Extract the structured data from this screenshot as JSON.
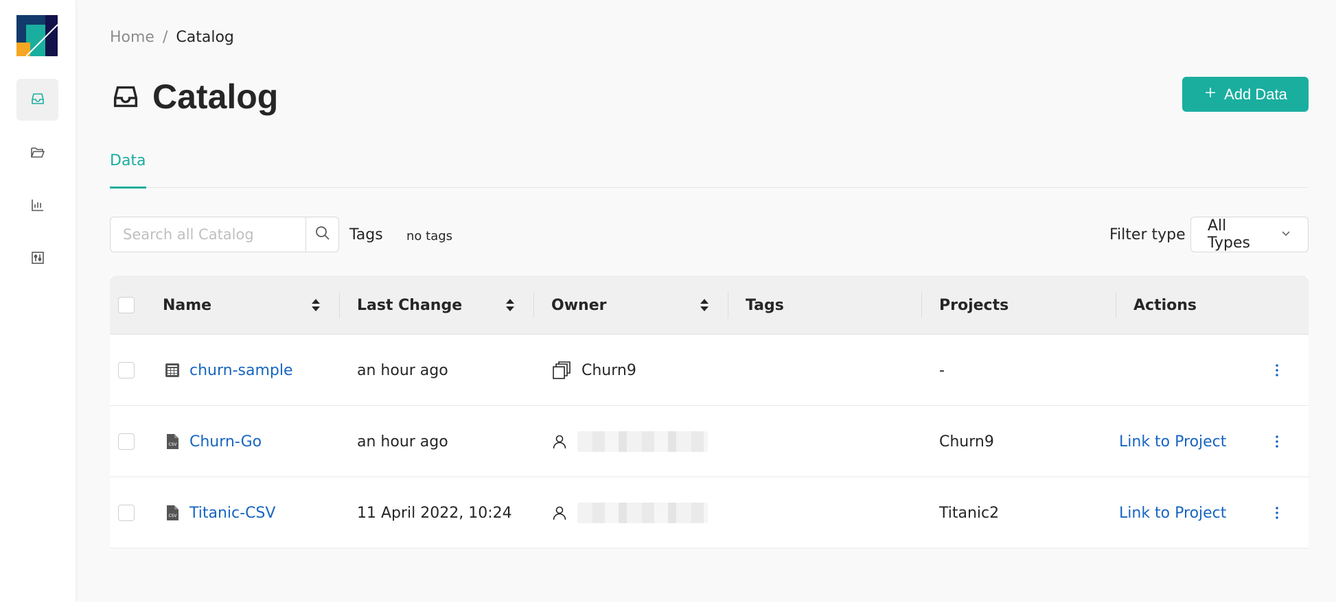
{
  "breadcrumb": {
    "home": "Home",
    "separator": "/",
    "current": "Catalog"
  },
  "page": {
    "title": "Catalog"
  },
  "actions": {
    "add_data": "Add Data"
  },
  "tabs": [
    {
      "label": "Data",
      "active": true
    }
  ],
  "search": {
    "placeholder": "Search all Catalog"
  },
  "tags": {
    "label": "Tags",
    "value": "no tags"
  },
  "filter": {
    "label": "Filter type",
    "value": "All Types"
  },
  "table": {
    "columns": {
      "name": "Name",
      "last_change": "Last Change",
      "owner": "Owner",
      "tags": "Tags",
      "projects": "Projects",
      "actions": "Actions"
    },
    "rows": [
      {
        "name": "churn-sample",
        "type_icon": "table-icon",
        "last_change": "an hour ago",
        "owner": "Churn9",
        "owner_icon": "stack-icon",
        "tags": "",
        "projects": "-",
        "action": ""
      },
      {
        "name": "Churn-Go",
        "type_icon": "csv-file-icon",
        "last_change": "an hour ago",
        "owner": "",
        "owner_icon": "user-icon",
        "tags": "",
        "projects": "Churn9",
        "action": "Link to Project"
      },
      {
        "name": "Titanic-CSV",
        "type_icon": "csv-file-icon",
        "last_change": "11 April 2022, 10:24",
        "owner": "",
        "owner_icon": "user-icon",
        "tags": "",
        "projects": "Titanic2",
        "action": "Link to Project"
      }
    ]
  },
  "colors": {
    "accent": "#1aae9f",
    "link": "#1765c0",
    "logo_navy": "#123a6b",
    "logo_dark": "#13124a",
    "logo_teal": "#1aae9f",
    "logo_orange": "#f5a623"
  }
}
